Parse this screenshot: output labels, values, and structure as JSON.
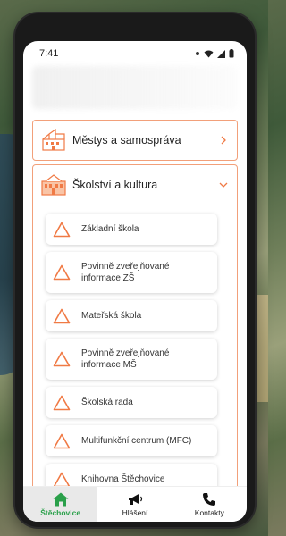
{
  "status": {
    "time": "7:41"
  },
  "categories": [
    {
      "label": "Městys a samospráva",
      "icon": "town-hall-icon",
      "expanded": false
    },
    {
      "label": "Školství a kultura",
      "icon": "school-icon",
      "expanded": true
    }
  ],
  "subitems": [
    {
      "label": "Základní škola"
    },
    {
      "label": "Povinně zveřejňované informace ZŠ"
    },
    {
      "label": "Mateřská škola"
    },
    {
      "label": "Povinně zveřejňované informace MŠ"
    },
    {
      "label": "Školská rada"
    },
    {
      "label": "Multifunkční centrum (MFC)"
    },
    {
      "label": "Knihovna Štěchovice"
    }
  ],
  "nav": [
    {
      "label": "Štěchovice",
      "icon": "home-icon",
      "active": true
    },
    {
      "label": "Hlášení",
      "icon": "megaphone-icon",
      "active": false
    },
    {
      "label": "Kontakty",
      "icon": "phone-icon",
      "active": false
    }
  ],
  "colors": {
    "accent": "#f07a45",
    "nav_active": "#2aa04a",
    "card_border": "#f2a07a"
  }
}
